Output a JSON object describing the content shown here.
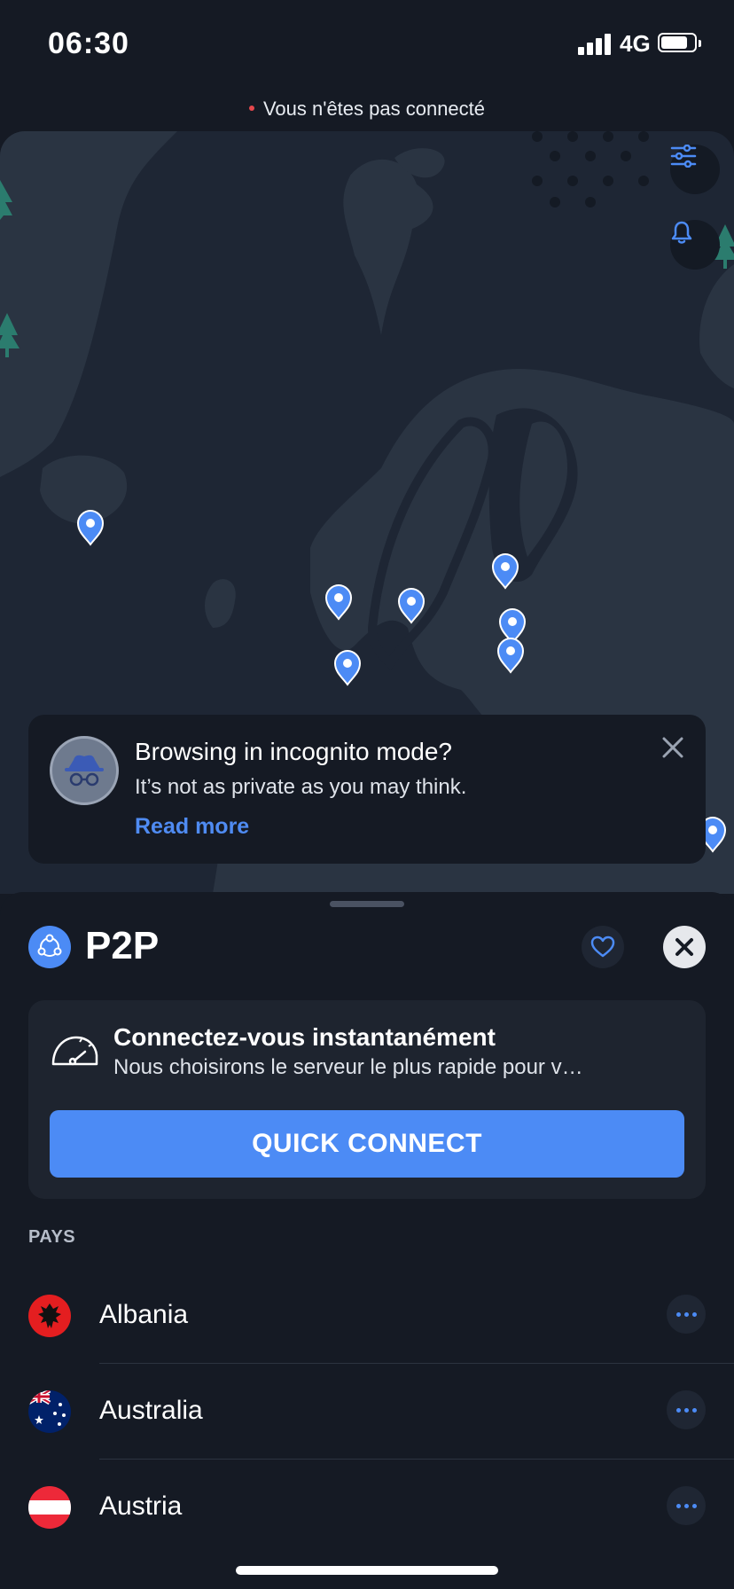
{
  "status_bar": {
    "time": "06:30",
    "network": "4G",
    "battery_level": 0.8
  },
  "connection": {
    "status_text": "Vous n'êtes pas connecté",
    "status_color": "#e5484d"
  },
  "map": {
    "buttons": [
      {
        "name": "filter-settings-button",
        "icon": "sliders-icon"
      },
      {
        "name": "notifications-button",
        "icon": "bell-icon"
      }
    ],
    "pin_color": "#4c8bf5"
  },
  "banner": {
    "title": "Browsing in incognito mode?",
    "subtitle": "It’s not as private as you may think.",
    "link": "Read more",
    "icon": "incognito-icon"
  },
  "sheet": {
    "title": "P2P",
    "quick_connect": {
      "title": "Connectez-vous instantanément",
      "subtitle": "Nous choisirons le serveur le plus rapide pour v…",
      "button_label": "QUICK CONNECT"
    },
    "section_label": "PAYS",
    "countries": [
      {
        "name": "Albania",
        "flag": "albania-flag"
      },
      {
        "name": "Australia",
        "flag": "australia-flag"
      },
      {
        "name": "Austria",
        "flag": "austria-flag"
      }
    ]
  },
  "colors": {
    "accent": "#4c8bf5",
    "background": "#151a24",
    "map_land": "#2a3442"
  }
}
